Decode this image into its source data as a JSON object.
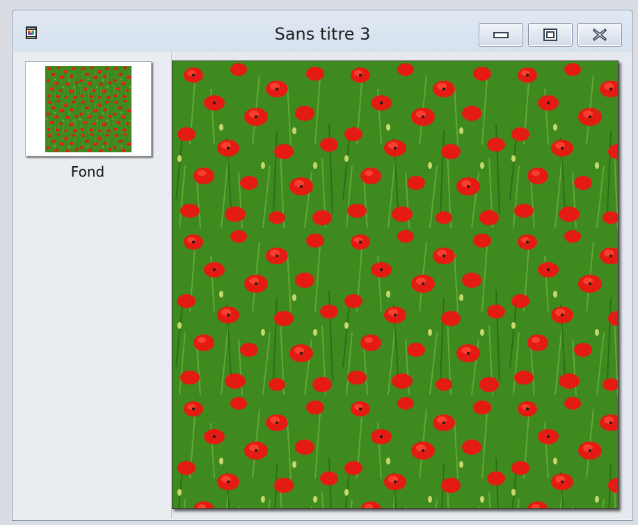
{
  "window": {
    "title": "Sans titre 3"
  },
  "titlebar": {
    "app_icon": "image-document-icon",
    "buttons": {
      "minimize_icon": "minimize-icon",
      "maximize_icon": "maximize-icon",
      "close_icon": "close-icon"
    }
  },
  "layers": [
    {
      "name": "Fond"
    }
  ],
  "canvas": {
    "content": "poppy-field-tiled-pattern"
  },
  "colors": {
    "grass": "#2f7a1a",
    "poppy": "#e31b12",
    "titlebar": "#dfe8f3"
  }
}
